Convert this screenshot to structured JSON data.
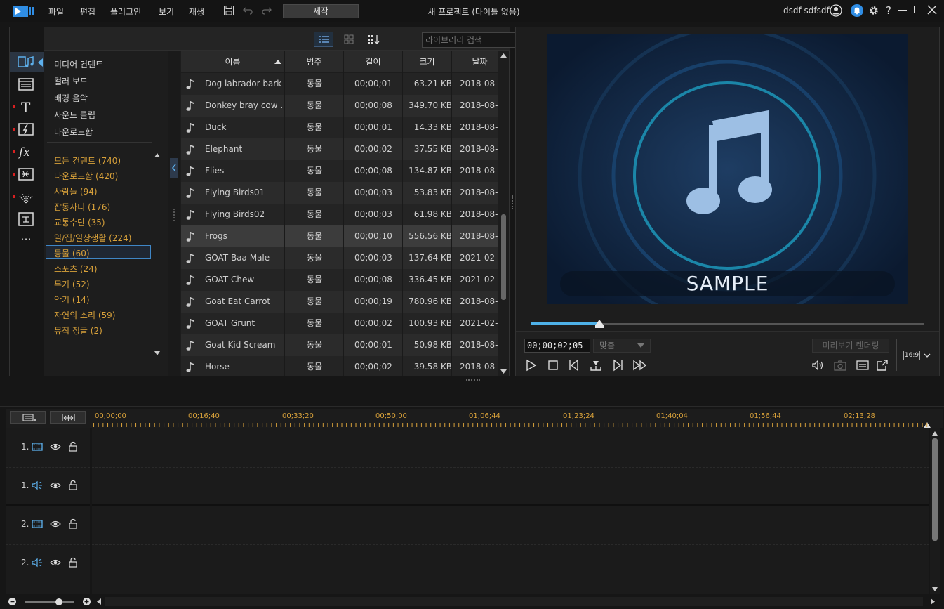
{
  "menu": [
    "파일",
    "편집",
    "플러그인",
    "보기",
    "재생"
  ],
  "produce_label": "제작",
  "project_title": "새 프로젝트 (타이틀 없음)",
  "user_name": "dsdf sdfsdf",
  "search": {
    "placeholder": "라이브러리 검색"
  },
  "media_menu": [
    "미디어 컨텐트",
    "컬러 보드",
    "배경 음악",
    "사운드 클립",
    "다운로드함"
  ],
  "categories": [
    "모든 컨텐트 (740)",
    "다운로드함 (420)",
    "사람들 (94)",
    "잡동사니 (176)",
    "교통수단 (35)",
    "일/집/일상생활 (224)",
    "동물 (60)",
    "스포츠 (24)",
    "무기 (52)",
    "악기 (14)",
    "자연의 소리 (59)",
    "뮤직 징글 (2)"
  ],
  "selected_category": "동물 (60)",
  "table": {
    "headers": [
      "이름",
      "범주",
      "길이",
      "크기",
      "날짜"
    ],
    "rows": [
      {
        "name": "Dog labrador bark",
        "category": "동물",
        "length": "00;00;01",
        "size": "63.21 KB",
        "date": "2018-08-"
      },
      {
        "name": "Donkey bray cow ...",
        "category": "동물",
        "length": "00;00;08",
        "size": "349.70 KB",
        "date": "2018-08-"
      },
      {
        "name": "Duck",
        "category": "동물",
        "length": "00;00;01",
        "size": "14.33 KB",
        "date": "2018-08-"
      },
      {
        "name": "Elephant",
        "category": "동물",
        "length": "00;00;02",
        "size": "37.55 KB",
        "date": "2018-08-"
      },
      {
        "name": "Flies",
        "category": "동물",
        "length": "00;00;08",
        "size": "134.87 KB",
        "date": "2018-08-"
      },
      {
        "name": "Flying Birds01",
        "category": "동물",
        "length": "00;00;03",
        "size": "53.83 KB",
        "date": "2018-08-"
      },
      {
        "name": "Flying Birds02",
        "category": "동물",
        "length": "00;00;03",
        "size": "61.98 KB",
        "date": "2018-08-"
      },
      {
        "name": "Frogs",
        "category": "동물",
        "length": "00;00;10",
        "size": "556.56 KB",
        "date": "2018-08-"
      },
      {
        "name": "GOAT Baa Male",
        "category": "동물",
        "length": "00;00;03",
        "size": "137.64 KB",
        "date": "2021-02-"
      },
      {
        "name": "GOAT Chew",
        "category": "동물",
        "length": "00;00;08",
        "size": "336.45 KB",
        "date": "2021-02-"
      },
      {
        "name": "Goat Eat  Carrot",
        "category": "동물",
        "length": "00;00;19",
        "size": "780.96 KB",
        "date": "2018-08-"
      },
      {
        "name": "GOAT Grunt",
        "category": "동물",
        "length": "00;00;02",
        "size": "100.93 KB",
        "date": "2021-02-"
      },
      {
        "name": "Goat Kid Scream",
        "category": "동물",
        "length": "00;00;01",
        "size": "50.98 KB",
        "date": "2018-08-"
      },
      {
        "name": "Horse",
        "category": "동물",
        "length": "00;00;02",
        "size": "39.58 KB",
        "date": "2018-08-"
      }
    ],
    "selected_row": "Frogs"
  },
  "preview": {
    "sample_text": "SAMPLE",
    "timecode": "00;00;02;05",
    "fit_label": "맞춤",
    "render_label": "미리보기 렌더링",
    "aspect_ratio": "16:9",
    "scrub_progress": 0.175
  },
  "timeline": {
    "ruler_labels": [
      "00;00;00",
      "00;16;40",
      "00;33;20",
      "00;50;00",
      "01;06;44",
      "01;23;24",
      "01;40;04",
      "01;56;44",
      "02;13;28"
    ],
    "tracks": [
      {
        "number": "1.",
        "type": "video"
      },
      {
        "number": "1.",
        "type": "audio"
      },
      {
        "number": "2.",
        "type": "video"
      },
      {
        "number": "2.",
        "type": "audio"
      }
    ]
  },
  "colors": {
    "accent": "#4eb1e8",
    "category_text": "#d8a13a",
    "selection_border": "#3f86c6",
    "notification": "#2f8de4",
    "rail_dot": "#d92020"
  }
}
